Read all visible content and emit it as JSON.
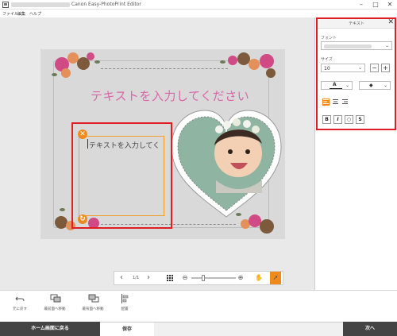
{
  "window": {
    "title": "Canon Easy-PhotoPrint Editor",
    "minimize": "–",
    "maximize": "□",
    "close": "✕"
  },
  "menu": {
    "file": "ファイル",
    "edit": "編集",
    "help": "ヘルプ"
  },
  "canvas": {
    "main_text": "テキストを入力してください",
    "textbox_text": "テキストを入力してく"
  },
  "handles": {
    "delete": "✕",
    "rotate": "↻"
  },
  "pager": {
    "prev": "‹",
    "page": "1/1",
    "next": "›",
    "zoom_out": "⊖",
    "zoom_in": "⊕"
  },
  "panel": {
    "title": "テキスト",
    "close": "✕",
    "font_label": "フォント",
    "size_label": "サイズ",
    "size_value": "10",
    "minus": "−",
    "plus": "+",
    "color_letter": "A",
    "bold": "B",
    "italic": "I",
    "outline": "○",
    "shadow": "S"
  },
  "tools": [
    {
      "label": "元に戻す",
      "icon": "undo-icon"
    },
    {
      "label": "最前面へ移動",
      "icon": "bring-to-front-icon"
    },
    {
      "label": "最背面へ移動",
      "icon": "send-to-back-icon"
    },
    {
      "label": "配置",
      "icon": "arrange-icon"
    }
  ],
  "footer": {
    "home": "ホーム画面に戻る",
    "save": "保存",
    "next": "次へ"
  },
  "colors": {
    "accent": "#f08a1c",
    "highlight": "#e11d24",
    "pink_text": "#d868a8",
    "dark_button": "#444444"
  }
}
